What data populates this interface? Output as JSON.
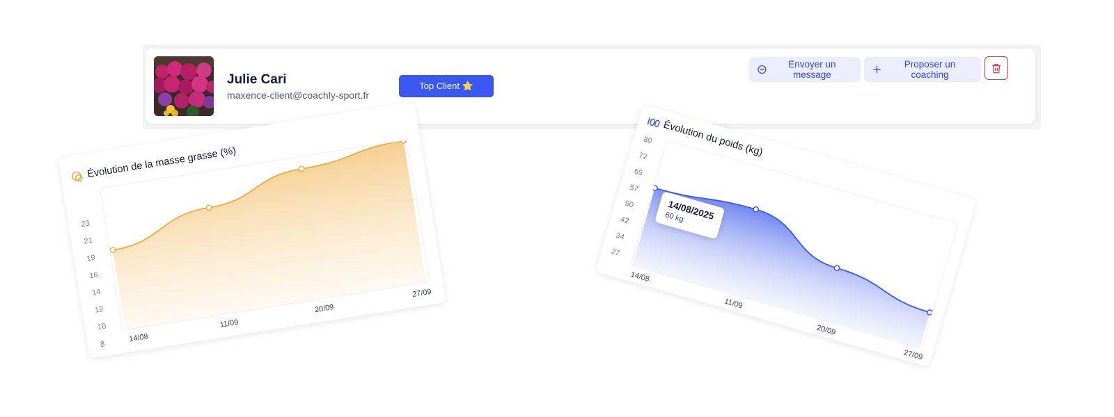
{
  "profile": {
    "name": "Julie Cari",
    "email": "maxence-client@coachly-sport.fr",
    "badge_label": "Top Client ⭐",
    "actions": {
      "message_label": "Envoyer un message",
      "coaching_label": "Proposer un coaching"
    },
    "icons": [
      "mail-icon",
      "plus-icon",
      "trash-icon",
      "flowers-photo"
    ]
  },
  "colors": {
    "accent": "#3a57f0",
    "fat_series": "#eeaa3c",
    "weight_series": "#3a57f0",
    "delete": "#e03a3a"
  },
  "chart_data": [
    {
      "type": "area",
      "title": "Évolution de la masse grasse (%)",
      "categories": [
        "14/08",
        "11/09",
        "20/09",
        "27/09"
      ],
      "values": [
        21.5,
        26,
        30,
        32
      ],
      "yticks": [
        "8",
        "10",
        "12",
        "14",
        "16",
        "19",
        "21",
        "23"
      ],
      "ylim": [
        8,
        32
      ],
      "grid": false,
      "legend": "none"
    },
    {
      "type": "area",
      "title": "Évolution du poids (kg)",
      "categories": [
        "14/08",
        "11/09",
        "20/09",
        "27/09"
      ],
      "values": [
        60,
        63,
        49,
        42
      ],
      "yticks": [
        "27",
        "34",
        "42",
        "50",
        "57",
        "65",
        "72",
        "80"
      ],
      "ylim": [
        27,
        80
      ],
      "grid": false,
      "legend": "none",
      "tooltip": {
        "date": "14/08/2025",
        "value": "60 kg"
      }
    }
  ]
}
